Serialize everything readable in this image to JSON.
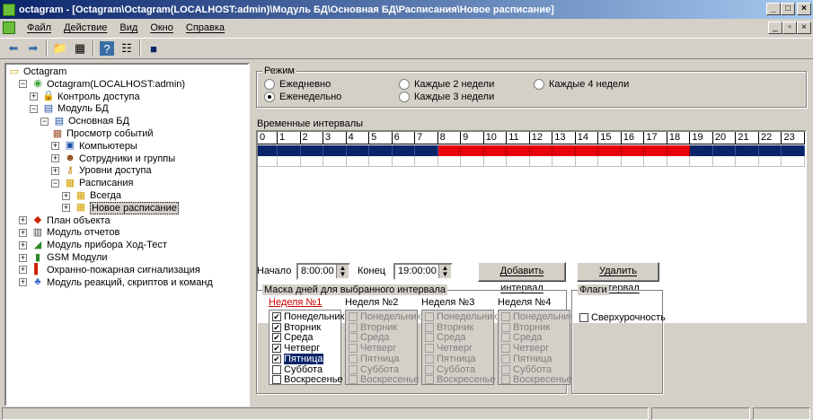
{
  "window": {
    "title": "octagram - [Octagram\\Octagram(LOCALHOST:admin)\\Модуль БД\\Основная БД\\Расписания\\Новое расписание]"
  },
  "menu": [
    "Файл",
    "Действие",
    "Вид",
    "Окно",
    "Справка"
  ],
  "toolbar": {
    "icons": [
      "back-arrow-icon",
      "forward-arrow-icon",
      "folder-up-icon",
      "view-icon",
      "help-icon",
      "list-icon",
      "save-icon"
    ]
  },
  "tree": [
    {
      "label": "Octagram",
      "indent": 0,
      "exp": "",
      "icon": "folder-icon"
    },
    {
      "label": "Octagram(LOCALHOST:admin)",
      "indent": 1,
      "exp": "−",
      "icon": "server-icon"
    },
    {
      "label": "Контроль доступа",
      "indent": 2,
      "exp": "+",
      "icon": "lock-icon"
    },
    {
      "label": "Модуль БД",
      "indent": 2,
      "exp": "−",
      "icon": "database-icon"
    },
    {
      "label": "Основная БД",
      "indent": 3,
      "exp": "−",
      "icon": "database-icon"
    },
    {
      "label": "Просмотр событий",
      "indent": 4,
      "exp": "",
      "icon": "events-icon"
    },
    {
      "label": "Компьютеры",
      "indent": 4,
      "exp": "+",
      "icon": "computer-icon"
    },
    {
      "label": "Сотрудники и группы",
      "indent": 4,
      "exp": "+",
      "icon": "users-icon"
    },
    {
      "label": "Уровни доступа",
      "indent": 4,
      "exp": "+",
      "icon": "key-icon"
    },
    {
      "label": "Расписания",
      "indent": 4,
      "exp": "−",
      "icon": "calendar-icon"
    },
    {
      "label": "Всегда",
      "indent": 5,
      "exp": "+",
      "icon": "schedule-icon"
    },
    {
      "label": "Новое расписание",
      "indent": 5,
      "exp": "+",
      "icon": "schedule-icon",
      "selected": true
    },
    {
      "label": "План объекта",
      "indent": 1,
      "exp": "+",
      "icon": "plan-icon"
    },
    {
      "label": "Модуль отчетов",
      "indent": 1,
      "exp": "+",
      "icon": "report-icon"
    },
    {
      "label": "Модуль прибора Ход-Тест",
      "indent": 1,
      "exp": "+",
      "icon": "device-icon"
    },
    {
      "label": "GSM Модули",
      "indent": 1,
      "exp": "+",
      "icon": "gsm-icon"
    },
    {
      "label": "Охранно-пожарная сигнализация",
      "indent": 1,
      "exp": "+",
      "icon": "alarm-icon"
    },
    {
      "label": "Модуль реакций, скриптов и команд",
      "indent": 1,
      "exp": "+",
      "icon": "script-icon"
    }
  ],
  "mode": {
    "label": "Режим",
    "options": [
      {
        "label": "Ежедневно",
        "checked": false
      },
      {
        "label": "Еженедельно",
        "checked": true
      },
      {
        "label": "Каждые 2 недели",
        "checked": false
      },
      {
        "label": "Каждые 3 недели",
        "checked": false
      },
      {
        "label": "Каждые 4 недели",
        "checked": false
      }
    ]
  },
  "intervals": {
    "label": "Временные интервалы",
    "hours": [
      "0",
      "1",
      "2",
      "3",
      "4",
      "5",
      "6",
      "7",
      "8",
      "9",
      "10",
      "11",
      "12",
      "13",
      "14",
      "15",
      "16",
      "17",
      "18",
      "19",
      "20",
      "21",
      "22",
      "23"
    ],
    "active_from": 8,
    "active_to": 19
  },
  "controls": {
    "start_label": "Начало",
    "start_value": "8:00:00",
    "end_label": "Конец",
    "end_value": "19:00:00",
    "add_button": "Добавить интервал",
    "delete_button": "Удалить интервал"
  },
  "mask": {
    "label": "Маска дней для выбранного интервала",
    "weeks": [
      {
        "title": "Неделя №1",
        "active": true,
        "checked": [
          true,
          true,
          true,
          true,
          true,
          false,
          false
        ],
        "highlight": 4
      },
      {
        "title": "Неделя №2",
        "active": false,
        "checked": [
          false,
          false,
          false,
          false,
          false,
          false,
          false
        ],
        "highlight": -1
      },
      {
        "title": "Неделя №3",
        "active": false,
        "checked": [
          false,
          false,
          false,
          false,
          false,
          false,
          false
        ],
        "highlight": -1
      },
      {
        "title": "Неделя №4",
        "active": false,
        "checked": [
          false,
          false,
          false,
          false,
          false,
          false,
          false
        ],
        "highlight": -1
      }
    ],
    "days": [
      "Понедельник",
      "Вторник",
      "Среда",
      "Четверг",
      "Пятница",
      "Суббота",
      "Воскресенье"
    ]
  },
  "flags": {
    "label": "Флаги",
    "overtime_label": "Сверхурочность",
    "overtime_checked": false
  },
  "colors": {
    "selected_row": "#0a246a",
    "active_interval": "#e8000f",
    "week1_title": "#cc0000"
  }
}
